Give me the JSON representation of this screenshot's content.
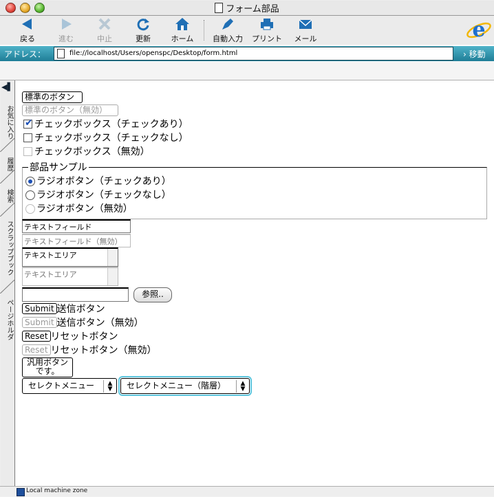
{
  "window": {
    "title": "フォーム部品"
  },
  "toolbar": {
    "back": "戻る",
    "forward": "進む",
    "stop": "中止",
    "refresh": "更新",
    "home": "ホーム",
    "autofill": "自動入力",
    "print": "プリント",
    "mail": "メール"
  },
  "address": {
    "label": "アドレス：",
    "url": "file://localhost/Users/openspc/Desktop/form.html",
    "go": "移動"
  },
  "sidebar": {
    "tabs": [
      "お気に入り",
      "履歴",
      "検索",
      "スクラップブック",
      "ページホルダ"
    ]
  },
  "form": {
    "button_std": "標準のボタン",
    "button_std_disabled": "標準のボタン（無効）",
    "checkbox_checked": "チェックボックス（チェックあり）",
    "checkbox_unchecked": "チェックボックス（チェックなし）",
    "checkbox_disabled": "チェックボックス（無効）",
    "fieldset_legend": "部品サンプル",
    "radio_checked": "ラジオボタン（チェックあり）",
    "radio_unchecked": "ラジオボタン（チェックなし）",
    "radio_disabled": "ラジオボタン（無効）",
    "textfield_value": "テキストフィールド",
    "textfield_disabled_value": "テキストフィールド（無効）",
    "textarea_value": "テキストエリア",
    "textarea_disabled_value": "テキストエリア",
    "browse_label": "参照..",
    "submit_label": "Submit",
    "submit_caption": "送信ボタン",
    "submit_disabled_label": "Submit",
    "submit_disabled_caption": "送信ボタン（無効）",
    "reset_label": "Reset",
    "reset_caption": "リセットボタン",
    "reset_disabled_label": "Reset",
    "reset_disabled_caption": "リセットボタン（無効）",
    "generic_button_line1": "汎用ボタン",
    "generic_button_line2": "です。",
    "select1_value": "セレクトメニュー",
    "select2_value": "セレクトメニュー（階層）"
  },
  "status": {
    "zone": "Local machine zone"
  },
  "colors": {
    "address_bar": "#2a90aa",
    "accent": "#1b4fb5",
    "focus_ring": "#5ec6de"
  }
}
